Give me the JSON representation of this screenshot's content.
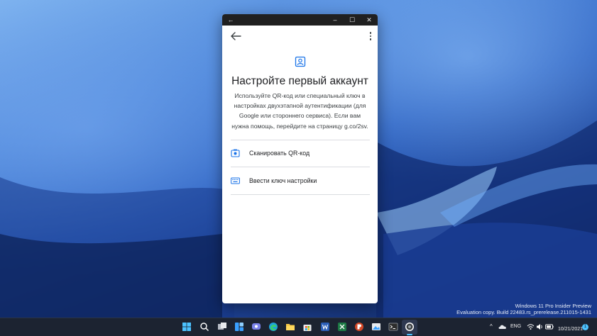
{
  "window": {
    "back_label": "←",
    "minimize_label": "–",
    "maximize_label": "☐",
    "close_label": "✕"
  },
  "app": {
    "title": "Настройте первый аккаунт",
    "description": "Используйте QR-код или специальный ключ в настройках двухэтапной аутентификации (для Google или стороннего сервиса). Если вам нужна помощь, перейдите на страницу g.co/2sv.",
    "options": [
      {
        "label": "Сканировать QR-код",
        "icon": "camera-icon"
      },
      {
        "label": "Ввести ключ настройки",
        "icon": "keyboard-icon"
      }
    ]
  },
  "desktop": {
    "watermark_line1": "Windows 11 Pro Insider Preview",
    "watermark_line2": "Evaluation copy. Build 22483.rs_prerelease.211015-1431"
  },
  "taskbar": {
    "language": "ENG",
    "date": "10/21/2021",
    "notification_count": "1",
    "tray_chevron": "^"
  },
  "colors": {
    "accent": "#1a73e8",
    "taskbar": "#1c2331"
  }
}
